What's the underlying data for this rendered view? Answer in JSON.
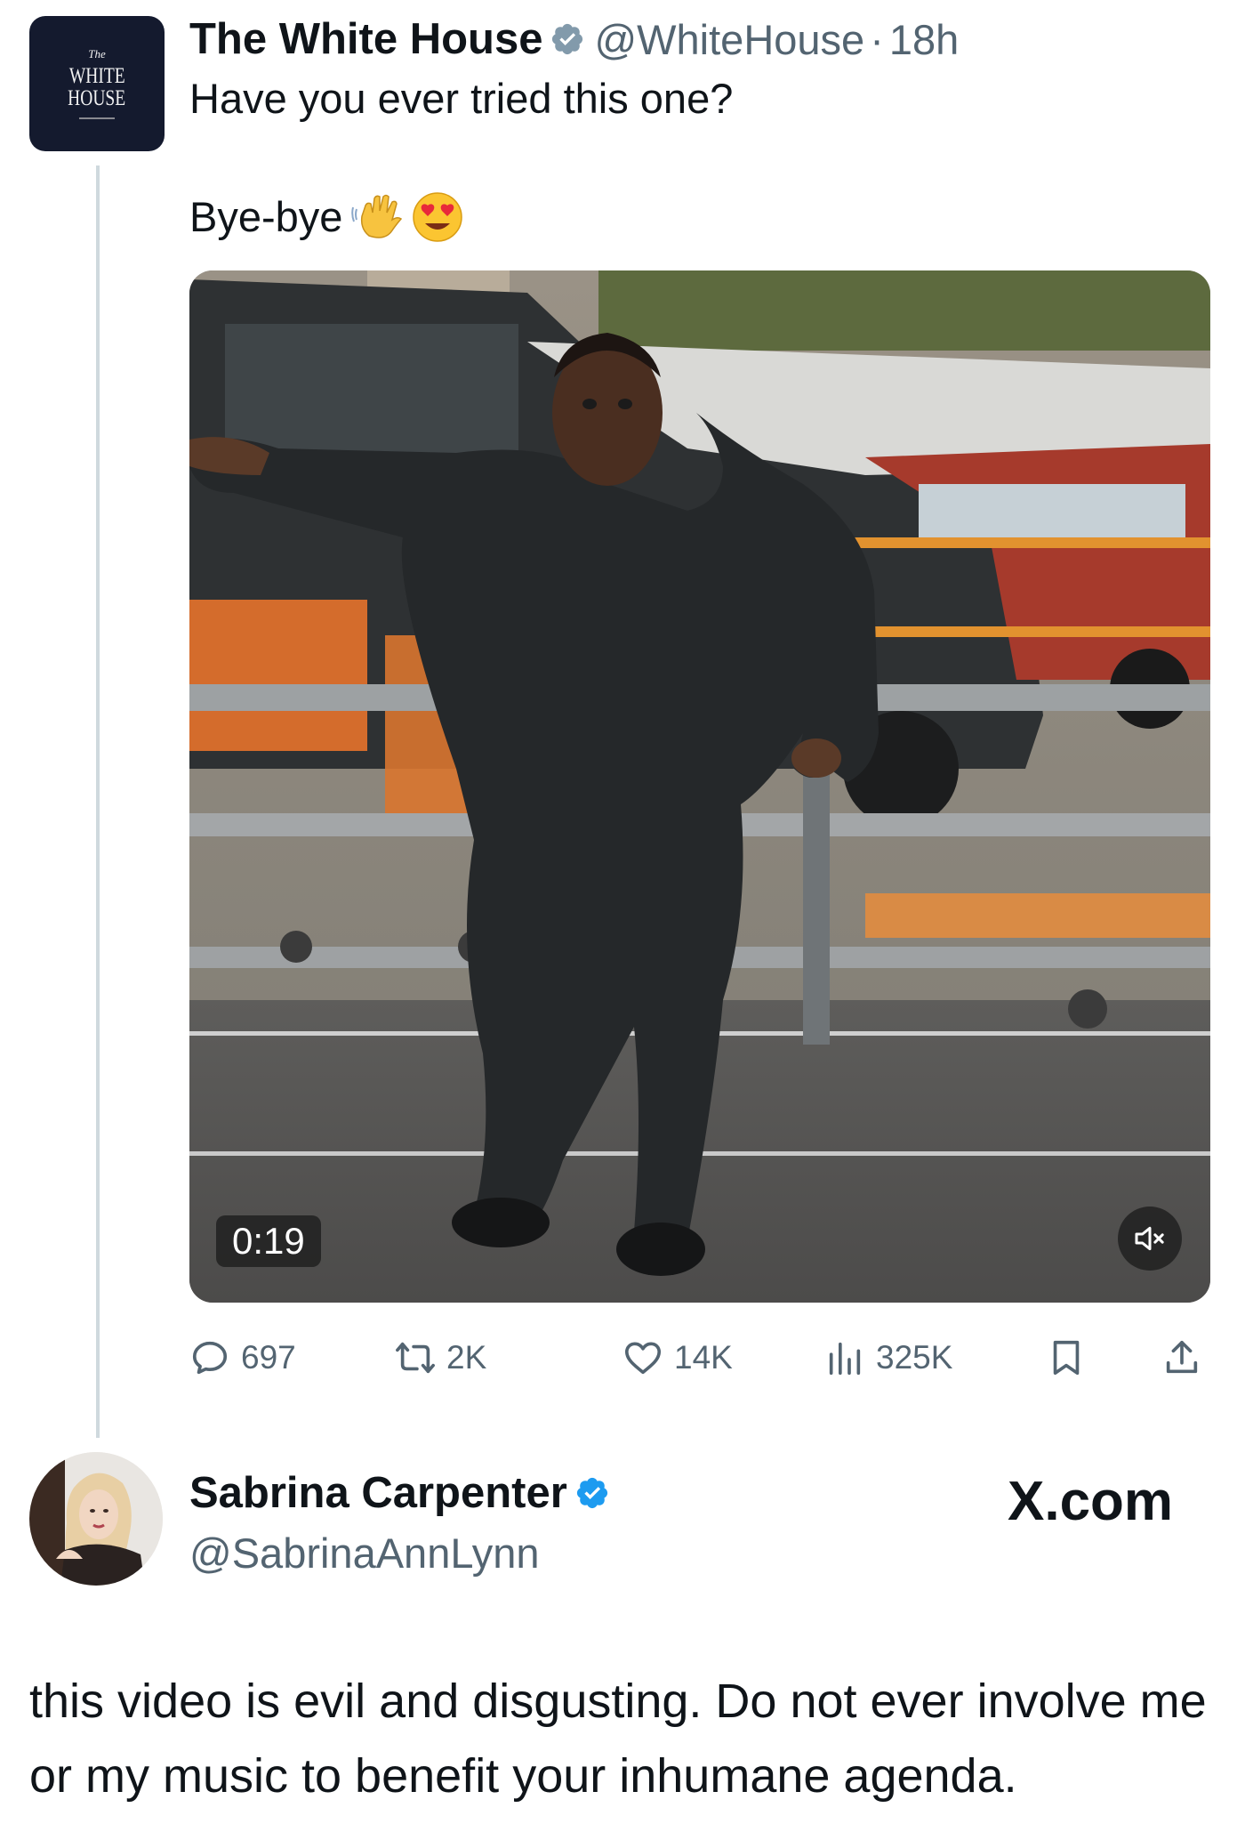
{
  "tweet": {
    "author_name": "The White House",
    "handle": "@WhiteHouse",
    "separator": "·",
    "time": "18h",
    "avatar_text": {
      "small": "The",
      "line1": "WHITE",
      "line2": "HOUSE"
    },
    "text_line1": "Have you ever tried this one?",
    "text_line2": "Bye-bye",
    "emojis": [
      "waving-hand-emoji",
      "heart-eyes-emoji"
    ],
    "video": {
      "duration": "0:19",
      "muted": true
    },
    "actions": {
      "replies": "697",
      "reposts": "2K",
      "likes": "14K",
      "views": "325K"
    }
  },
  "reply": {
    "author_name": "Sabrina Carpenter",
    "handle": "@SabrinaAnnLynn",
    "watermark": "X.com",
    "text": "this video is evil and disgusting. Do not ever involve me or my music to benefit your inhumane agenda."
  },
  "colors": {
    "text_primary": "#0f1419",
    "text_secondary": "#536471",
    "verified_gray": "#829aab",
    "verified_blue": "#1d9bf0",
    "thread_line": "#cfd9de"
  }
}
